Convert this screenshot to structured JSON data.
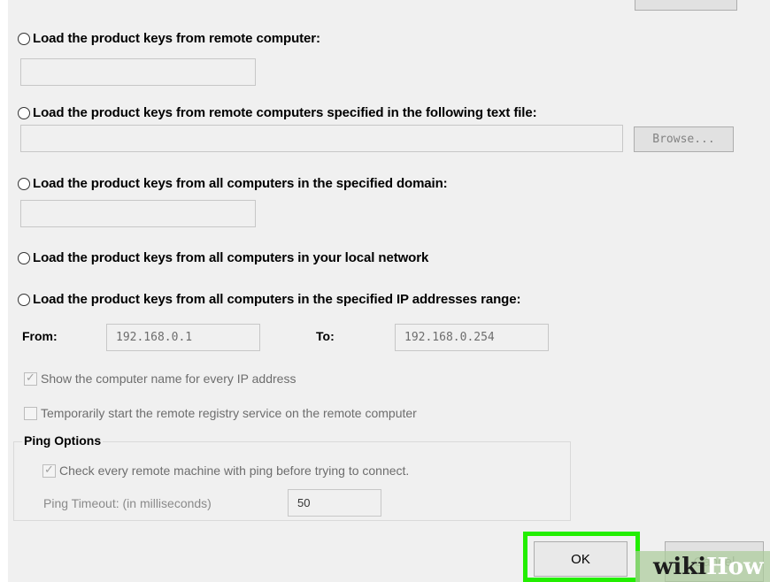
{
  "options": {
    "remote_computer": "Load the product keys from remote computer:",
    "remote_computers_file": "Load the product keys from remote computers specified in the following text file:",
    "domain": "Load the product keys from all computers in the specified domain:",
    "local_network": "Load the product keys from all computers in your local network",
    "ip_range": "Load the product keys from all computers in the specified IP addresses range:"
  },
  "inputs": {
    "remote_computer_value": "",
    "file_path_value": "",
    "domain_value": ""
  },
  "browse_label": "Browse...",
  "ip_range": {
    "from_label": "From:",
    "from_value": "192.168.0.1",
    "to_label": "To:",
    "to_value": "192.168.0.254"
  },
  "checkboxes": {
    "show_computer_name": {
      "label": "Show the computer name for every IP address",
      "checked": true
    },
    "start_remote_registry": {
      "label": "Temporarily start the remote registry service on the remote computer",
      "checked": false
    }
  },
  "ping_options": {
    "title": "Ping Options",
    "check_ping": {
      "label": "Check every remote machine with ping before trying to connect.",
      "checked": true
    },
    "timeout_label": "Ping Timeout: (in milliseconds)",
    "timeout_value": "50"
  },
  "buttons": {
    "ok": "OK",
    "cancel": "Cancel"
  },
  "watermark": {
    "wiki": "wiki",
    "how": "How"
  },
  "colors": {
    "highlight": "#22ee00",
    "dialog_bg": "#f0f0f0"
  }
}
